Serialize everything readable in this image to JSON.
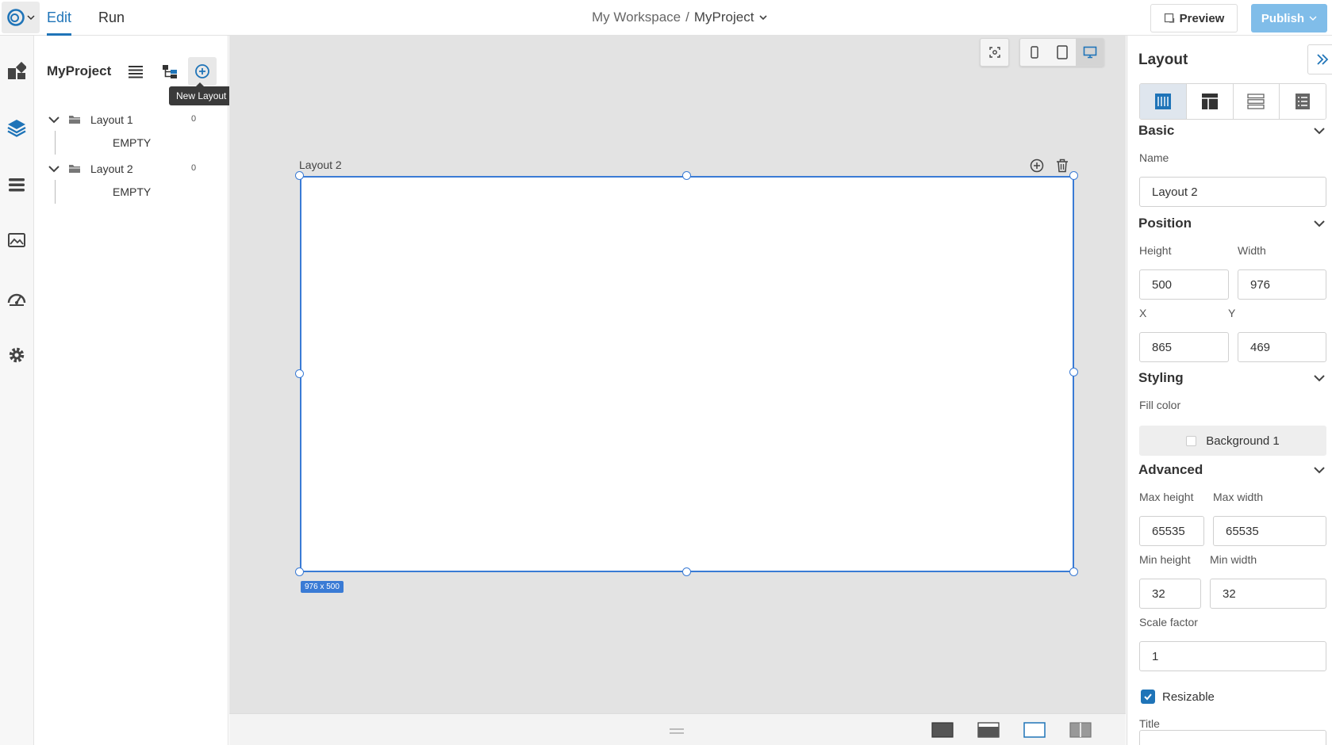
{
  "header": {
    "mode_tabs": [
      "Edit",
      "Run"
    ],
    "breadcrumb": {
      "workspace": "My Workspace",
      "separator": "/",
      "project": "MyProject"
    },
    "preview_label": "Preview",
    "publish_label": "Publish"
  },
  "project_panel": {
    "title": "MyProject",
    "tooltip": "New Layout",
    "tree": [
      {
        "label": "Layout 1",
        "count": "0",
        "child": "EMPTY"
      },
      {
        "label": "Layout 2",
        "count": "0",
        "child": "EMPTY"
      }
    ]
  },
  "canvas": {
    "layout_label": "Layout 2",
    "size_badge": "976 x 500"
  },
  "properties": {
    "title": "Layout",
    "basic": {
      "heading": "Basic",
      "name_label": "Name",
      "name_value": "Layout 2"
    },
    "position": {
      "heading": "Position",
      "height_label": "Height",
      "height_value": "500",
      "width_label": "Width",
      "width_value": "976",
      "x_label": "X",
      "x_value": "865",
      "y_label": "Y",
      "y_value": "469"
    },
    "styling": {
      "heading": "Styling",
      "fill_label": "Fill color",
      "fill_value": "Background 1"
    },
    "advanced": {
      "heading": "Advanced",
      "max_height_label": "Max height",
      "max_height_value": "65535",
      "max_width_label": "Max width",
      "max_width_value": "65535",
      "min_height_label": "Min height",
      "min_height_value": "32",
      "min_width_label": "Min width",
      "min_width_value": "32",
      "scale_label": "Scale factor",
      "scale_value": "1",
      "resizable_label": "Resizable",
      "title_label": "Title"
    }
  },
  "colors": {
    "accent": "#1f74b8",
    "selection": "#3a7bd5",
    "publish_bg": "#80bde9",
    "canvas_bg": "#e3e3e3"
  }
}
